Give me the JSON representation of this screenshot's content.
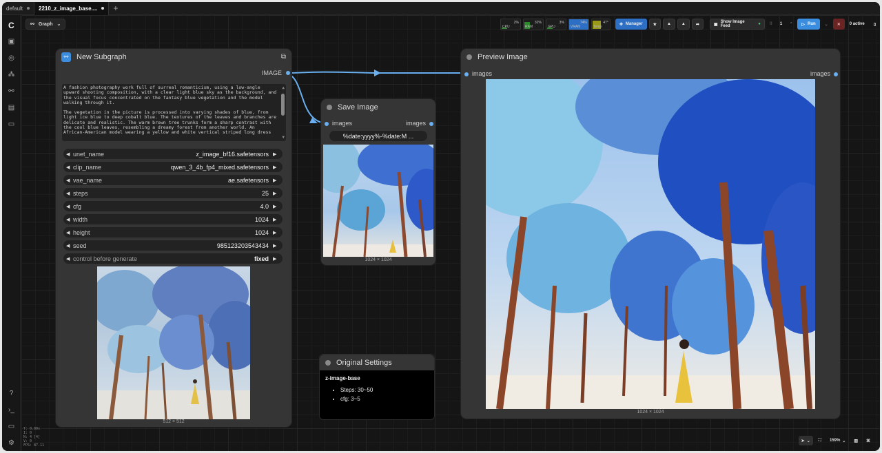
{
  "tabs": [
    {
      "label": "default",
      "active": false
    },
    {
      "label": "2210_z_image_base....",
      "active": true
    }
  ],
  "tab_add": "+",
  "toolbar": {
    "graph_label": "Graph",
    "meters": [
      {
        "label": "CPU",
        "pct": "2%",
        "color": "#2a6a2a"
      },
      {
        "label": "RAM",
        "pct": "32%",
        "color": "#2a7a2a"
      },
      {
        "label": "GPU",
        "pct": "3%",
        "color": "#2a6a2a"
      },
      {
        "label": "VRAM",
        "pct": "74%",
        "color": "#2d6fc4"
      },
      {
        "label": "Temp",
        "pct": "47°",
        "color": "#8a8a1a"
      }
    ],
    "manager_label": "Manager",
    "show_image_feed_label": "Show Image Feed",
    "queue_count": "1",
    "run_label": "Run",
    "active_label": "0 active"
  },
  "stats_text": [
    "T: 0.00s",
    "I: 0",
    "N: 4 [4]",
    "V: 0",
    "FPS: 87.11"
  ],
  "subgraph_node": {
    "title": "New Subgraph",
    "output_label": "IMAGE",
    "prompt_paragraphs": [
      "A fashion photography work full of surreal romanticism, using a low-angle upward shooting composition, with a clear light blue sky as the background, and the visual focus concentrated on the fantasy blue vegetation and the model walking through it.",
      "The vegetation in the picture is processed into varying shades of blue, from light ice blue to deep cobalt blue. The textures of the leaves and branches are delicate and realistic. The warm brown tree trunks form a sharp contrast with the cool blue leaves, resembling a dreamy forest from another world. An African-American model wearing a yellow and white vertical striped long dress"
    ],
    "widgets": [
      {
        "name": "unet_name",
        "value": "z_image_bf16.safetensors"
      },
      {
        "name": "clip_name",
        "value": "qwen_3_4b_fp4_mixed.safetensors"
      },
      {
        "name": "vae_name",
        "value": "ae.safetensors"
      },
      {
        "name": "steps",
        "value": "25"
      },
      {
        "name": "cfg",
        "value": "4.0"
      },
      {
        "name": "width",
        "value": "1024"
      },
      {
        "name": "height",
        "value": "1024"
      },
      {
        "name": "seed",
        "value": "985123203543434"
      },
      {
        "name": "control before generate",
        "value": "fixed"
      }
    ],
    "image_size": "512 × 512"
  },
  "save_node": {
    "title": "Save Image",
    "input_label": "images",
    "output_label": "images",
    "filename_prefix": "%date:yyyy%-%date:M ...",
    "image_size": "1024 × 1024"
  },
  "preview_node": {
    "title": "Preview Image",
    "input_label": "images",
    "output_label": "images",
    "image_size": "1024 × 1024"
  },
  "note_node": {
    "title": "Original Settings",
    "heading": "z-image-base",
    "items": [
      "Steps: 30~50",
      "cfg: 3~5"
    ]
  },
  "bottom_bar": {
    "zoom": "159%"
  }
}
